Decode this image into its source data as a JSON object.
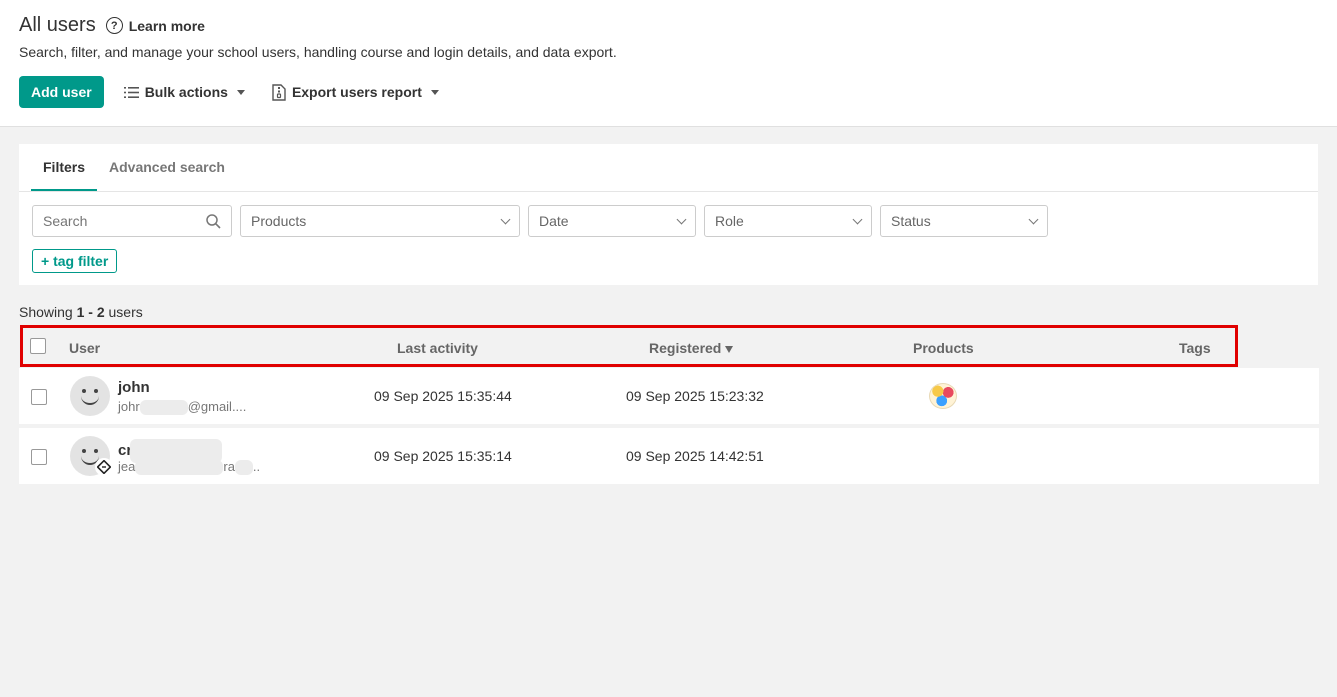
{
  "header": {
    "title": "All users",
    "learn_more": "Learn more",
    "subtitle": "Search, filter, and manage your school users, handling course and login details, and data export.",
    "add_user": "Add user",
    "bulk_actions": "Bulk actions",
    "export_report": "Export users report"
  },
  "filters": {
    "tabs": [
      "Filters",
      "Advanced search"
    ],
    "search_placeholder": "Search",
    "products": "Products",
    "date": "Date",
    "role": "Role",
    "status": "Status",
    "tag_filter": "+ tag filter"
  },
  "showing": {
    "prefix": "Showing",
    "range": "1 - 2",
    "suffix": "users"
  },
  "table": {
    "columns": [
      "User",
      "Last activity",
      "Registered",
      "Products",
      "Tags"
    ],
    "rows": [
      {
        "name": "john",
        "email_start": "johr",
        "email_end": "@gmail....",
        "last_activity": "09 Sep 2025 15:35:44",
        "registered": "09 Sep 2025 15:23:32",
        "has_product": true
      },
      {
        "name": "cr",
        "email_start": "jea",
        "email_mid": "ra",
        "email_end": "..",
        "last_activity": "09 Sep 2025 15:35:14",
        "registered": "09 Sep 2025 14:42:51",
        "has_product": false
      }
    ]
  },
  "colors": {
    "accent": "#00998a",
    "highlight": "#e00000"
  }
}
